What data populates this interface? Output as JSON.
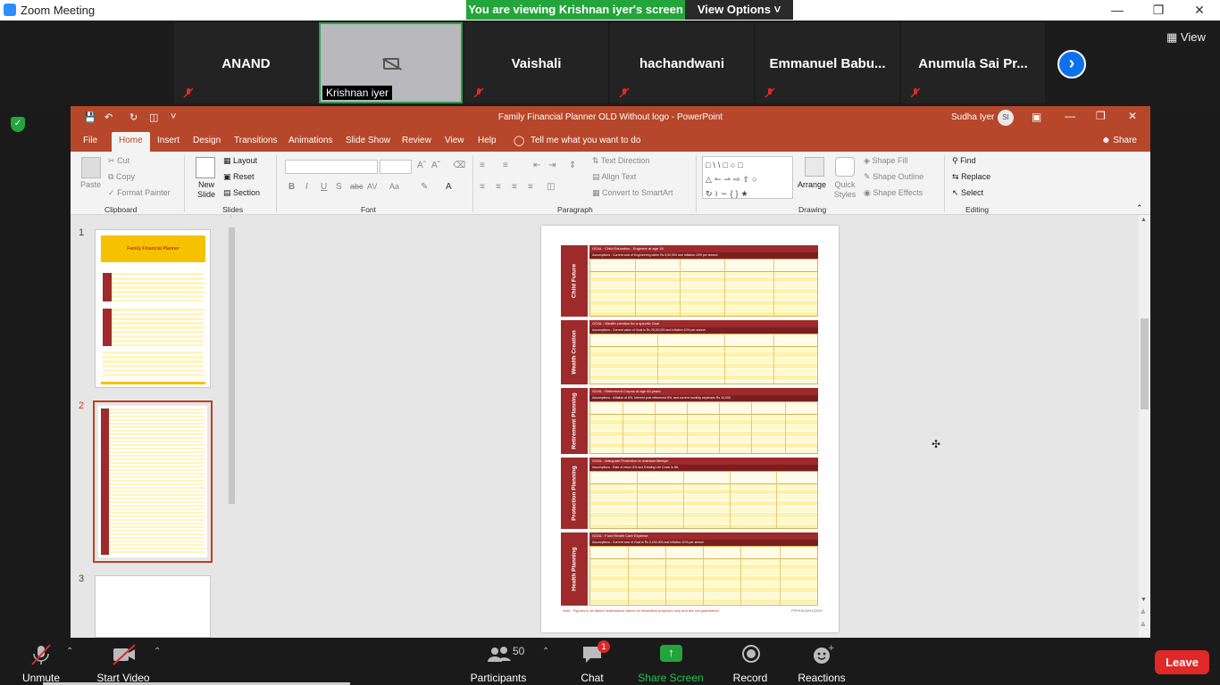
{
  "zoom": {
    "window_title": "Zoom Meeting",
    "share_banner": "You are viewing Krishnan iyer's screen",
    "view_options": "View Options",
    "view_button": "View",
    "participants_tiles": [
      {
        "name": "ANAND"
      },
      {
        "name": "Krishnan iyer"
      },
      {
        "name": "Vaishali"
      },
      {
        "name": "hachandwani"
      },
      {
        "name": "Emmanuel Babu..."
      },
      {
        "name": "Anumula Sai Pr..."
      }
    ],
    "toolbar": {
      "unmute": "Unmute",
      "start_video": "Start Video",
      "participants": "Participants",
      "participants_count": "50",
      "chat": "Chat",
      "chat_badge": "1",
      "share_screen": "Share Screen",
      "record": "Record",
      "reactions": "Reactions",
      "leave": "Leave"
    }
  },
  "powerpoint": {
    "title": "Family Financial Planner OLD Without logo  -  PowerPoint",
    "user": "Sudha Iyer",
    "user_initials": "SI",
    "share": "Share",
    "tabs": [
      "File",
      "Home",
      "Insert",
      "Design",
      "Transitions",
      "Animations",
      "Slide Show",
      "Review",
      "View",
      "Help"
    ],
    "tell_me": "Tell me what you want to do",
    "ribbon": {
      "clipboard": {
        "paste": "Paste",
        "cut": "Cut",
        "copy": "Copy",
        "format_painter": "Format Painter",
        "label": "Clipboard"
      },
      "slides": {
        "new_slide": "New Slide",
        "layout": "Layout",
        "reset": "Reset",
        "section": "Section",
        "label": "Slides"
      },
      "font": {
        "label": "Font"
      },
      "paragraph": {
        "text_direction": "Text Direction",
        "align_text": "Align Text",
        "convert": "Convert to SmartArt",
        "label": "Paragraph"
      },
      "drawing": {
        "arrange": "Arrange",
        "quick_styles": "Quick Styles",
        "shape_fill": "Shape Fill",
        "shape_outline": "Shape Outline",
        "shape_effects": "Shape Effects",
        "label": "Drawing"
      },
      "editing": {
        "find": "Find",
        "replace": "Replace",
        "select": "Select",
        "label": "Editing"
      }
    },
    "thumbnails": [
      "1",
      "2",
      "3"
    ],
    "thumb1_title": "Family Financial Planner",
    "slide": {
      "sections": [
        {
          "side": "Child Future",
          "head": "GOAL : Child Education - Engineer at age 18",
          "sub": "Assumptions : Current cost of Engineering taken Rs 5,00,000 and Inflation 10% per annum"
        },
        {
          "side": "Wealth Creation",
          "head": "GOAL : Wealth creation for a specific Goal",
          "sub": "Assumptions : Current value of Goal is Rs 25,00,000 and Inflation 10% per annum"
        },
        {
          "side": "Retirement Planning",
          "head": "GOAL : Retirement Corpus at age 60 years",
          "sub": "Assumptions : Inflation at 6%, Interest post retirement 8%, and current monthly expenses Rs 10,000"
        },
        {
          "side": "Protection Planning",
          "head": "GOAL : Adequate Protection to maintain lifestyle",
          "sub": "Assumptions : Rate of return 8% and Existing Life Cover is NIL"
        },
        {
          "side": "Health Planning",
          "head": "GOAL : Fund Health Care Expense",
          "sub": "Assumptions : Current cost of Goal is Rs 2,000,000 and Inflation 10% per annum"
        }
      ],
      "note": "Note : Figures in all tables hereinabove above for illustrative purposes only and are not guaranteed",
      "id": "FFP/10/10/V1/2020"
    }
  }
}
